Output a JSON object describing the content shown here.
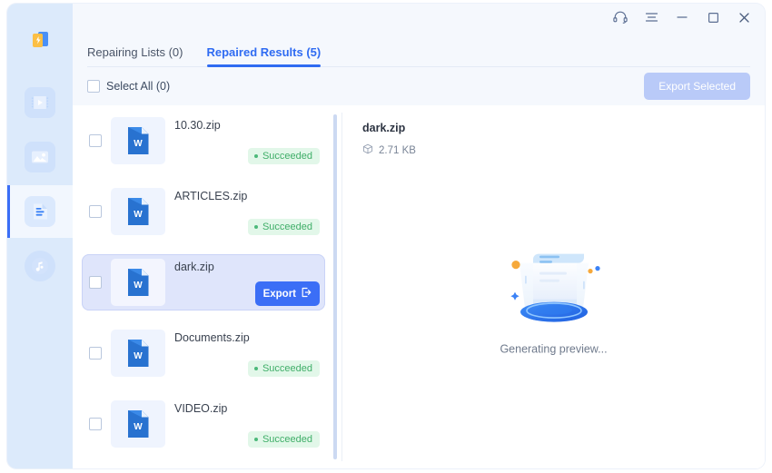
{
  "window": {
    "titlebar_buttons": [
      {
        "name": "support-headset",
        "label": "Support"
      },
      {
        "name": "menu",
        "label": "Menu"
      },
      {
        "name": "minimize",
        "label": "Minimize"
      },
      {
        "name": "maximize",
        "label": "Maximize"
      },
      {
        "name": "close",
        "label": "Close"
      }
    ]
  },
  "sidebar": {
    "items": [
      {
        "id": "logo",
        "label": "App Logo",
        "icon": "file-repair-logo-icon",
        "active": false
      },
      {
        "id": "video",
        "label": "Video Repair",
        "icon": "video-icon",
        "active": false
      },
      {
        "id": "photo",
        "label": "Photo Repair",
        "icon": "image-icon",
        "active": false
      },
      {
        "id": "file",
        "label": "File Repair",
        "icon": "document-icon",
        "active": true
      },
      {
        "id": "audio",
        "label": "Audio Repair",
        "icon": "music-note-icon",
        "active": false
      }
    ]
  },
  "tabs": [
    {
      "id": "repairing",
      "label": "Repairing Lists (0)",
      "active": false
    },
    {
      "id": "repaired",
      "label": "Repaired Results (5)",
      "active": true
    }
  ],
  "toolbar": {
    "select_all_label": "Select All (0)",
    "export_selected_label": "Export Selected",
    "export_selected_disabled": true
  },
  "file_list": [
    {
      "name": "10.30.zip",
      "icon": "word-file-icon",
      "status": "Succeeded",
      "selected": false,
      "checked": false,
      "action": null
    },
    {
      "name": "ARTICLES.zip",
      "icon": "word-file-icon",
      "status": "Succeeded",
      "selected": false,
      "checked": false,
      "action": null
    },
    {
      "name": "dark.zip",
      "icon": "word-file-icon",
      "status": null,
      "selected": true,
      "checked": false,
      "action": "Export"
    },
    {
      "name": "Documents.zip",
      "icon": "word-file-icon",
      "status": "Succeeded",
      "selected": false,
      "checked": false,
      "action": null
    },
    {
      "name": "VIDEO.zip",
      "icon": "word-file-icon",
      "status": "Succeeded",
      "selected": false,
      "checked": false,
      "action": null
    }
  ],
  "preview": {
    "file_name": "dark.zip",
    "file_size": "2.71 KB",
    "size_icon": "package-box-icon",
    "loading_text": "Generating preview...",
    "illustration": "document-scroll-on-disc-illustration"
  },
  "colors": {
    "accent": "#3b6ef6",
    "tab_active": "#2f6bf2",
    "sidebar_bg": "#dceafb",
    "panel_bg": "#f5f8fd",
    "selected_row": "#dfe5fb",
    "success": "#4cb97a",
    "success_bg": "#e2f7e9",
    "disabled_button": "#b9caf8"
  }
}
